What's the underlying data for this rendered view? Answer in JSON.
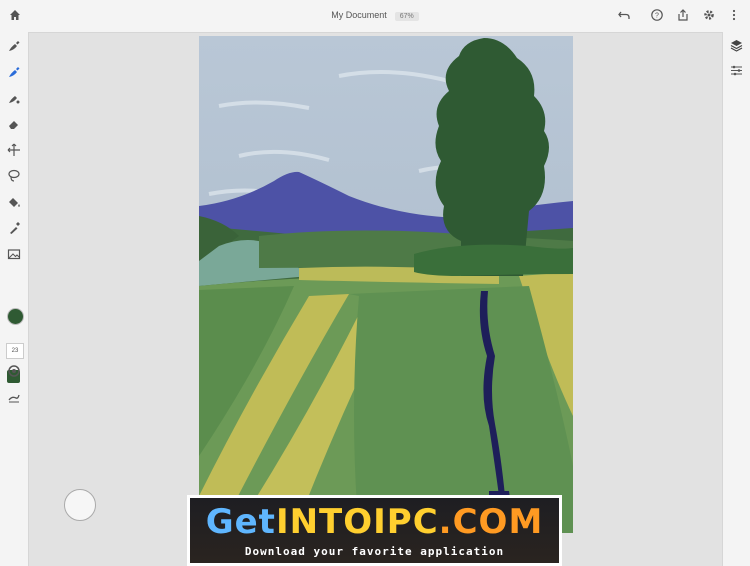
{
  "document": {
    "title": "My Document",
    "zoom": "67%"
  },
  "toolbar_left": {
    "tools": [
      "brush-pixel-icon",
      "brush-live-icon",
      "brush-vector-icon",
      "eraser-icon",
      "move-icon",
      "lasso-icon",
      "fill-icon",
      "eyedropper-icon",
      "image-icon"
    ],
    "brush_size": "23",
    "current_color": "#2f5a33"
  },
  "toolbar_right": {
    "tools": [
      "layers-icon",
      "properties-icon"
    ]
  },
  "topbar_right": {
    "tools": [
      "undo-icon",
      "help-icon",
      "share-icon",
      "settings-icon"
    ]
  },
  "watermark": {
    "brand_part1": "Get",
    "brand_part2": "INTO",
    "brand_part3": "IPC",
    "brand_part4": ".COM",
    "tagline": "Download your favorite application"
  }
}
